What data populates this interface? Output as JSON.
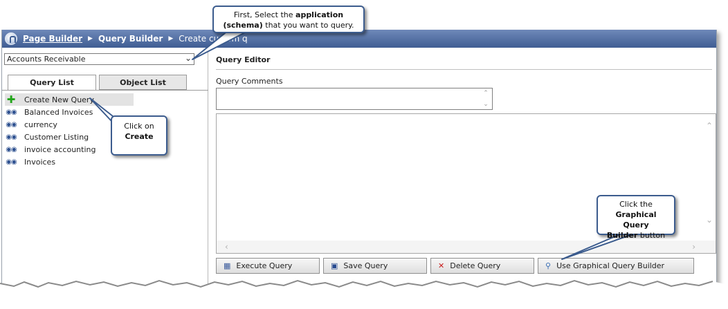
{
  "breadcrumb": {
    "link": "Page Builder",
    "current": "Query Builder",
    "tail": "Create custom q"
  },
  "schema_select": {
    "value": "Accounts Receivable"
  },
  "tabs": [
    {
      "label": "Query List",
      "active": true
    },
    {
      "label": "Object List",
      "active": false
    }
  ],
  "query_list": [
    {
      "label": "Create New Query",
      "icon": "plus-icon"
    },
    {
      "label": "Balanced Invoices",
      "icon": "binoculars-icon"
    },
    {
      "label": "currency",
      "icon": "binoculars-icon"
    },
    {
      "label": "Customer Listing",
      "icon": "binoculars-icon"
    },
    {
      "label": "invoice accounting",
      "icon": "binoculars-icon"
    },
    {
      "label": "Invoices",
      "icon": "binoculars-icon"
    }
  ],
  "editor": {
    "title": "Query Editor",
    "comments_label": "Query Comments"
  },
  "buttons": {
    "execute": "Execute Query",
    "save": "Save Query",
    "delete": "Delete Query",
    "graphical": "Use Graphical Query Builder"
  },
  "callouts": {
    "schema": {
      "line1_pre": "First, Select the ",
      "line1_bold": "application",
      "line2_bold": "(schema)",
      "line2_post": " that you want to query."
    },
    "create": {
      "line1": "Click on",
      "line2_bold": "Create"
    },
    "graphical": {
      "line1": "Click the",
      "line2_bold": "Graphical Query",
      "line3_bold": "Builder",
      "line3_post": " button"
    }
  },
  "colors": {
    "topbar": "#4f6ea5",
    "callout_border": "#3c5c8e",
    "plus_icon": "#22a51a",
    "delete_icon": "#c81a1a"
  }
}
